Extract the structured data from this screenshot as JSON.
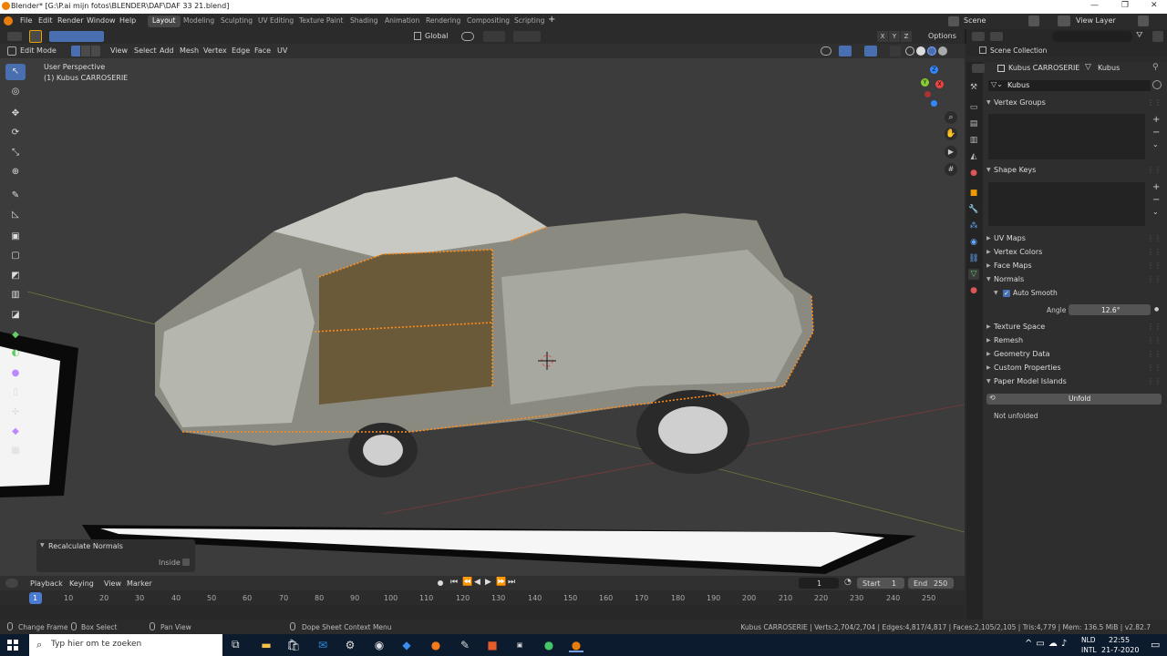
{
  "window": {
    "title": "Blender* [G:\\P.ai mijn fotos\\BLENDER\\DAF\\DAF 33 21.blend]"
  },
  "menus": [
    "File",
    "Edit",
    "Render",
    "Window",
    "Help"
  ],
  "workspaces": [
    "Layout",
    "Modeling",
    "Sculpting",
    "UV Editing",
    "Texture Paint",
    "Shading",
    "Animation",
    "Rendering",
    "Compositing",
    "Scripting"
  ],
  "scene": {
    "label": "Scene",
    "view_layer": "View Layer"
  },
  "toolbar": {
    "orientation": "Global",
    "options": "Options"
  },
  "editheader": {
    "mode": "Edit Mode",
    "menus": [
      "View",
      "Select",
      "Add",
      "Mesh",
      "Vertex",
      "Edge",
      "Face",
      "UV"
    ]
  },
  "viewport": {
    "perspective": "User Perspective",
    "object": "(1) Kubus CARROSERIE",
    "gizmo_x": "X",
    "gizmo_y": "Y",
    "gizmo_z": "Z"
  },
  "xyz": [
    "X",
    "Y",
    "Z"
  ],
  "redo_panel": {
    "title": "Recalculate Normals",
    "inside_label": "Inside",
    "inside_checked": false
  },
  "outliner": {
    "title": "Scene Collection"
  },
  "properties": {
    "object_name": "Kubus CARROSERIE",
    "mesh_name": "Kubus",
    "data_field": "Kubus",
    "sections": {
      "vertex_groups": "Vertex Groups",
      "shape_keys": "Shape Keys",
      "uv_maps": "UV Maps",
      "vertex_colors": "Vertex Colors",
      "face_maps": "Face Maps",
      "normals": "Normals",
      "auto_smooth": "Auto Smooth",
      "angle_label": "Angle",
      "angle_value": "12.6°",
      "texture_space": "Texture Space",
      "remesh": "Remesh",
      "geometry_data": "Geometry Data",
      "custom_properties": "Custom Properties",
      "paper_model": "Paper Model Islands",
      "unfold": "Unfold",
      "not_unfolded": "Not unfolded"
    }
  },
  "timeline": {
    "playback": "Playback",
    "keying": "Keying",
    "view": "View",
    "marker": "Marker",
    "current_frame": "1",
    "start_label": "Start",
    "start": "1",
    "end_label": "End",
    "end": "250",
    "ruler": [
      "1",
      "10",
      "20",
      "30",
      "40",
      "50",
      "60",
      "70",
      "80",
      "90",
      "100",
      "110",
      "120",
      "130",
      "140",
      "150",
      "160",
      "170",
      "180",
      "190",
      "200",
      "210",
      "220",
      "230",
      "240",
      "250"
    ]
  },
  "status": {
    "change_frame": "Change Frame",
    "box_select": "Box Select",
    "pan_view": "Pan View",
    "context_menu": "Dope Sheet Context Menu",
    "stats": "Kubus CARROSERIE | Verts:2,704/2,704 | Edges:4,817/4,817 | Faces:2,105/2,105 | Tris:4,779 | Mem: 136.5 MiB | v2.82.7"
  },
  "taskbar": {
    "search_placeholder": "Typ hier om te zoeken",
    "lang": "NLD",
    "layout": "INTL",
    "time": "22:55",
    "date": "21-7-2020"
  },
  "colors": {
    "accent": "#4a6fb0",
    "select": "#ff8c1a",
    "active_ws": "#474747"
  }
}
